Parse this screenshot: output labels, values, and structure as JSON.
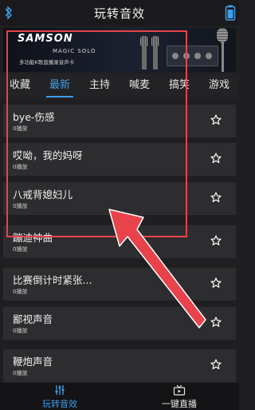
{
  "header": {
    "title": "玩转音效"
  },
  "banner": {
    "brand": "SAMSON",
    "model": "MAGIC SOLO",
    "slogan": "多功能K歌直播录音声卡"
  },
  "tabs": [
    {
      "label": "收藏",
      "active": false
    },
    {
      "label": "最新",
      "active": true
    },
    {
      "label": "主持",
      "active": false
    },
    {
      "label": "喊麦",
      "active": false
    },
    {
      "label": "搞笑",
      "active": false
    },
    {
      "label": "游戏",
      "active": false
    }
  ],
  "sounds": [
    {
      "name": "bye-伤感",
      "plays": "0播放"
    },
    {
      "name": "哎呦，我的妈呀",
      "plays": "0播放"
    },
    {
      "name": "八戒背媳妇儿",
      "plays": "0播放"
    },
    {
      "name": "蹦迪神曲",
      "plays": "0播放"
    },
    {
      "name": "比赛倒计时紧张...",
      "plays": "0播放"
    },
    {
      "name": "鄙视声音",
      "plays": "0播放"
    },
    {
      "name": "鞭炮声音",
      "plays": "0播放"
    }
  ],
  "bottom_nav": [
    {
      "label": "玩转音效",
      "icon": "sliders-icon",
      "active": true
    },
    {
      "label": "一键直播",
      "icon": "tv-icon",
      "active": false
    }
  ],
  "colors": {
    "accent": "#3f9de8",
    "annotation": "#e8434b",
    "background": "#1f1f21",
    "row": "#2d2d30"
  }
}
